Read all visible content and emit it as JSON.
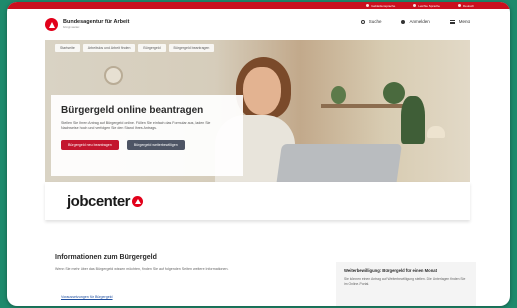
{
  "top_bar": {
    "items": [
      "Gebärdensprache",
      "Leichte Sprache",
      "Deutsch"
    ]
  },
  "header": {
    "org_name": "Bundesagentur für Arbeit",
    "org_tagline": "bringt weiter.",
    "nav": {
      "search": "Suche",
      "login": "Anmelden",
      "menu": "Menü"
    }
  },
  "breadcrumbs": [
    "Startseite",
    "Arbeitslos und Arbeit finden",
    "Bürgergeld",
    "Bürgergeld beantragen"
  ],
  "hero": {
    "title": "Bürgergeld online beantragen",
    "text": "Stellen Sie Ihren Antrag auf Bürgergeld online. Füllen Sie einfach das Formular aus, laden Sie Nachweise hoch und verfolgen Sie den Stand Ihres Antrags.",
    "primary_button": "Bürgergeld neu beantragen",
    "secondary_button": "Bürgergeld weiterbewilligen"
  },
  "jobcenter": {
    "brand": "jobcenter"
  },
  "info": {
    "title": "Informationen zum Bürgergeld",
    "text": "Wenn Sie mehr über das Bürgergeld wissen möchten, finden Sie auf folgenden Seiten weitere Informationen.",
    "link": "Voraussetzungen für Bürgergeld"
  },
  "side_card": {
    "title": "Weiterbewilligung: Bürgergeld für einen Monat",
    "text": "Sie können einen Antrag auf Weiterbewilligung stellen. Die Unterlagen finden Sie im Online-Portal."
  },
  "colors": {
    "brand_red": "#e2001a",
    "button_red": "#c3162e",
    "button_gray": "#4e5565",
    "background_green": "#1e8a6c"
  }
}
